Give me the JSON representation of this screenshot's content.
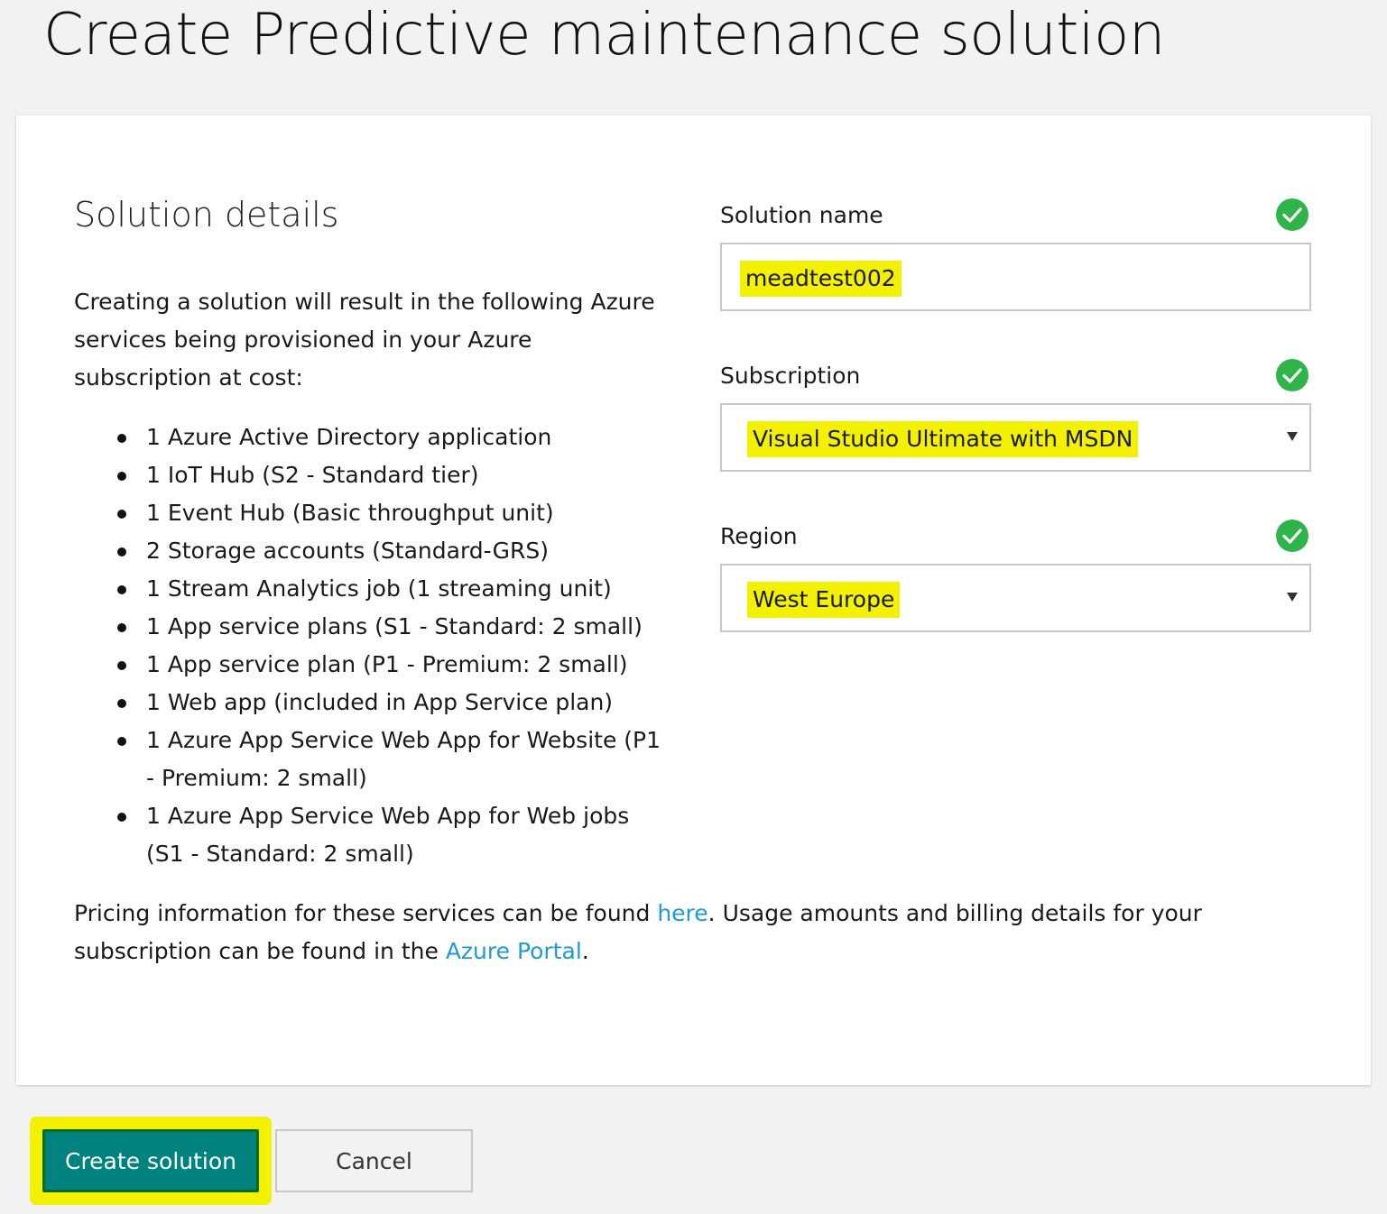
{
  "page": {
    "title": "Create Predictive maintenance solution"
  },
  "details": {
    "heading": "Solution details",
    "intro": "Creating a solution will result in the following Azure services being provisioned in your Azure subscription at cost:",
    "services": [
      "1 Azure Active Directory application",
      "1 IoT Hub (S2 - Standard tier)",
      "1 Event Hub (Basic throughput unit)",
      "2 Storage accounts (Standard-GRS)",
      "1 Stream Analytics job (1 streaming unit)",
      "1 App service plans (S1 - Standard: 2 small)",
      "1 App service plan (P1 - Premium: 2 small)",
      "1 Web app (included in App Service plan)",
      "1 Azure App Service Web App for Website (P1 - Premium: 2 small)",
      "1 Azure App Service Web App for Web jobs (S1 - Standard: 2 small)"
    ],
    "pricing_part1": "Pricing information for these services can be found ",
    "pricing_link": "here",
    "pricing_part2": ". Usage amounts and billing details for your subscription can be found in the ",
    "portal_link": "Azure Portal",
    "pricing_part3": "."
  },
  "form": {
    "solution_name": {
      "label": "Solution name",
      "value": "meadtest002"
    },
    "subscription": {
      "label": "Subscription",
      "value": "Visual Studio Ultimate with MSDN"
    },
    "region": {
      "label": "Region",
      "value": "West Europe"
    }
  },
  "actions": {
    "create_label": "Create solution",
    "cancel_label": "Cancel"
  },
  "colors": {
    "background": "#f2f2f2",
    "card": "#ffffff",
    "accent": "#00827f",
    "link": "#1f9ad6",
    "valid": "#2fb44a",
    "highlight": "#f4f100"
  },
  "icons": {
    "valid": "check-circle-icon",
    "dropdown": "chevron-down-icon"
  }
}
